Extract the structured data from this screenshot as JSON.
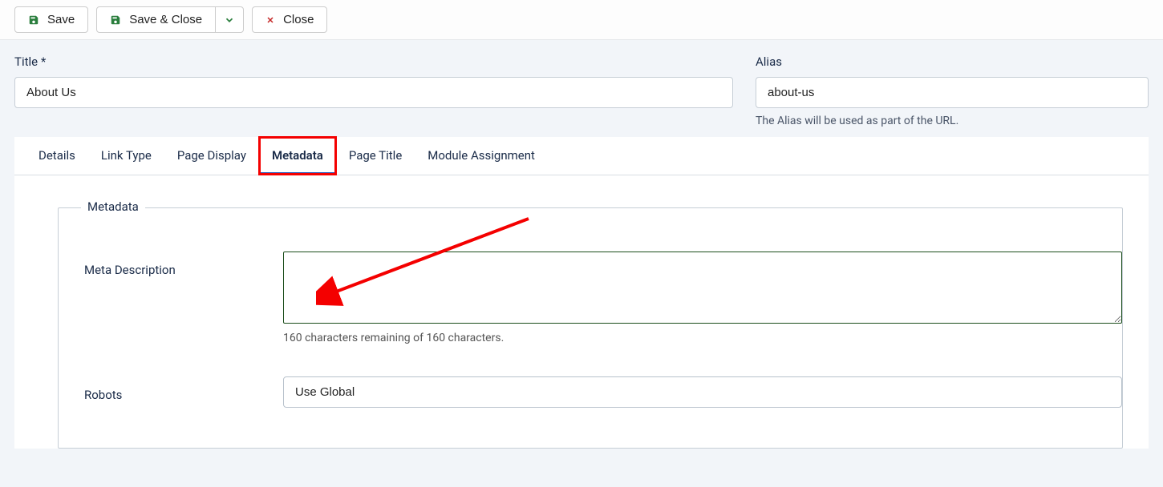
{
  "toolbar": {
    "save_label": "Save",
    "save_close_label": "Save & Close",
    "close_label": "Close"
  },
  "header": {
    "title_label": "Title *",
    "title_value": "About Us",
    "alias_label": "Alias",
    "alias_value": "about-us",
    "alias_help": "The Alias will be used as part of the URL."
  },
  "tabs": {
    "details": "Details",
    "link_type": "Link Type",
    "page_display": "Page Display",
    "metadata": "Metadata",
    "page_title": "Page Title",
    "module_assignment": "Module Assignment"
  },
  "metadata": {
    "legend": "Metadata",
    "meta_description_label": "Meta Description",
    "meta_description_value": "",
    "char_counter": "160 characters remaining of 160 characters.",
    "robots_label": "Robots",
    "robots_value": "Use Global"
  }
}
